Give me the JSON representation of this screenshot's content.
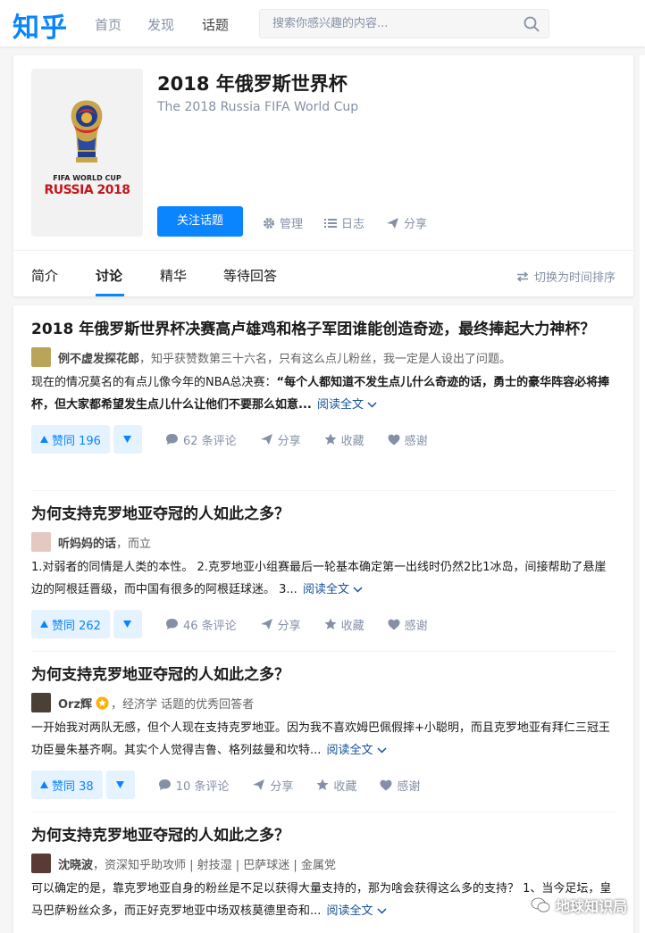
{
  "brand": {
    "logo_text": "知乎",
    "accent": "#0a84ff"
  },
  "nav": [
    {
      "label": "首页"
    },
    {
      "label": "发现"
    },
    {
      "label": "话题"
    }
  ],
  "search": {
    "placeholder": "搜索你感兴趣的内容...",
    "icon": "search-icon"
  },
  "topic": {
    "title": "2018 年俄罗斯世界杯",
    "subtitle": "The 2018 Russia FIFA World Cup",
    "image_text_line1": "FIFA WORLD CUP",
    "image_text_line2": "RUSSIA 2018",
    "follow_label": "关注话题",
    "actions": [
      {
        "icon": "gear-icon",
        "label": "管理"
      },
      {
        "icon": "list-icon",
        "label": "日志"
      },
      {
        "icon": "share-icon",
        "label": "分享"
      }
    ],
    "tabs": [
      {
        "label": "简介"
      },
      {
        "label": "讨论"
      },
      {
        "label": "精华"
      },
      {
        "label": "等待回答"
      }
    ],
    "active_tab": "讨论",
    "sort_label": "切换为时间排序"
  },
  "feed": [
    {
      "title": "2018 年俄罗斯世界杯决赛高卢雄鸡和格子军团谁能创造奇迹，最终捧起大力神杯？",
      "author": "例不虚发探花郎",
      "bio": "，知乎获赞数第三十六名，只有这么点儿粉丝，我一定是人设出了问题。",
      "excerpt_plain": "现在的情况莫名的有点儿像今年的NBA总决赛：",
      "excerpt_bold": "“每个人都知道不发生点儿什么奇迹的话，勇士的豪华阵容必将捧杯，但大家都希望发生点儿什么让他们不要那么如意...",
      "read_more": "阅读全文",
      "votes": "赞同 196",
      "comments": "62 条评论",
      "share": "分享",
      "collect": "收藏",
      "thanks": "感谢"
    },
    {
      "title": "为何支持克罗地亚夺冠的人如此之多？",
      "author": "听妈妈的话",
      "bio": "，而立",
      "excerpt_plain": "1.对弱者的同情是人类的本性。 2.克罗地亚小组赛最后一轮基本确定第一出线时仍然2比1冰岛，间接帮助了悬崖边的阿根廷晋级，而中国有很多的阿根廷球迷。 3...",
      "excerpt_bold": "",
      "read_more": "阅读全文",
      "votes": "赞同 262",
      "comments": "46 条评论",
      "share": "分享",
      "collect": "收藏",
      "thanks": "感谢"
    },
    {
      "title": "为何支持克罗地亚夺冠的人如此之多？",
      "author": "Orz辉",
      "bio": "，经济学 话题的优秀回答者",
      "excerpt_plain": "一开始我对两队无感，但个人现在支持克罗地亚。因为我不喜欢姆巴佩假摔+小聪明，而且克罗地亚有拜仁三冠王功臣曼朱基齐啊。其实个人觉得吉鲁、格列兹曼和坎特...",
      "excerpt_bold": "",
      "read_more": "阅读全文",
      "votes": "赞同 38",
      "comments": "10 条评论",
      "share": "分享",
      "collect": "收藏",
      "thanks": "感谢"
    },
    {
      "title": "为何支持克罗地亚夺冠的人如此之多？",
      "author": "沈晓波",
      "bio": "，资深知乎助攻师 | 射技湿 | 巴萨球迷 | 金属党",
      "excerpt_plain": "可以确定的是，靠克罗地亚自身的粉丝是不足以获得大量支持的，那为啥会获得这么多的支持？ 1、当今足坛，皇马巴萨粉丝众多，而正好克罗地亚中场双核莫德里奇和...",
      "excerpt_bold": "",
      "read_more": "阅读全文"
    }
  ],
  "watermark": "地球知识局"
}
